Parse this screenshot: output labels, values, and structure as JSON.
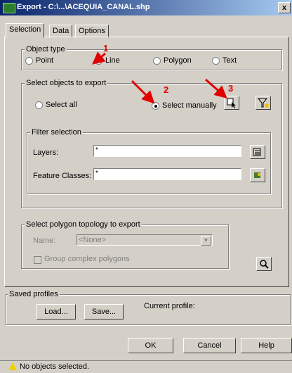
{
  "window": {
    "title": "Export - C:\\...\\ACEQUIA_CANAL.shp",
    "close": "x"
  },
  "tabs": [
    {
      "label": "Selection"
    },
    {
      "label": "Data"
    },
    {
      "label": "Options"
    }
  ],
  "object_type": {
    "label": "Object type",
    "options": [
      {
        "label": "Point"
      },
      {
        "label": "Line"
      },
      {
        "label": "Polygon"
      },
      {
        "label": "Text"
      }
    ],
    "selected": "Line"
  },
  "select_objects": {
    "label": "Select objects to export",
    "select_all": "Select all",
    "select_manually": "Select manually",
    "selected": "Select manually"
  },
  "filter": {
    "label": "Filter selection",
    "layers_label": "Layers:",
    "layers_value": "*",
    "classes_label": "Feature Classes:",
    "classes_value": "*"
  },
  "topology": {
    "label": "Select polygon topology to export",
    "name_label": "Name:",
    "name_value": "<None>",
    "group_label": "Group complex polygons"
  },
  "profiles": {
    "label": "Saved profiles",
    "load": "Load...",
    "save": "Save...",
    "current": "Current profile:"
  },
  "buttons": {
    "ok": "OK",
    "cancel": "Cancel",
    "help": "Help"
  },
  "annotations": {
    "m1": "1",
    "m2": "2",
    "m3": "3"
  },
  "status": {
    "text": "No objects selected."
  },
  "colors": {
    "annotation": "#e00000",
    "title_start": "#0a246a",
    "title_end": "#a6caf0"
  }
}
